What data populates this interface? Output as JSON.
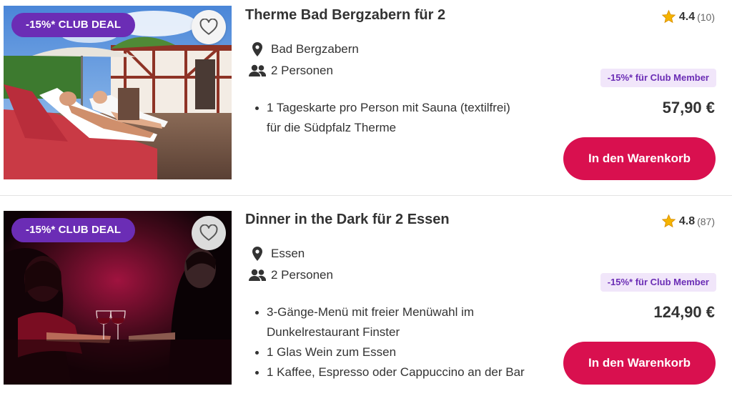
{
  "products": [
    {
      "badge": "-15%* CLUB DEAL",
      "title": "Therme Bad Bergzabern für 2",
      "rating": "4.4",
      "rating_count": "(10)",
      "location": "Bad Bergzabern",
      "persons": "2 Personen",
      "member_tag": "-15%* für Club Member",
      "price": "57,90 €",
      "bullets": [
        "1 Tageskarte pro Person mit Sauna (textilfrei)",
        "für die Südpfalz Therme"
      ],
      "cart_label": "In den Warenkorb"
    },
    {
      "badge": "-15%* CLUB DEAL",
      "title": "Dinner in the Dark für 2 Essen",
      "rating": "4.8",
      "rating_count": "(87)",
      "location": "Essen",
      "persons": "2 Personen",
      "member_tag": "-15%* für Club Member",
      "price": "124,90 €",
      "bullets": [
        "3-Gänge-Menü mit freier Menüwahl im",
        "Dunkelrestaurant Finster",
        "1 Glas Wein zum Essen",
        "1 Kaffee, Espresso oder Cappuccino an der Bar"
      ],
      "cart_label": "In den Warenkorb"
    }
  ],
  "icons": {
    "heart": "heart-outline-icon",
    "star": "star-icon",
    "location": "location-pin-icon",
    "persons": "persons-icon"
  },
  "colors": {
    "club_purple": "#6b2db5",
    "cart_red": "#d9104f",
    "star_gold": "#f5b400",
    "member_tag_bg": "#f1e6fa"
  }
}
